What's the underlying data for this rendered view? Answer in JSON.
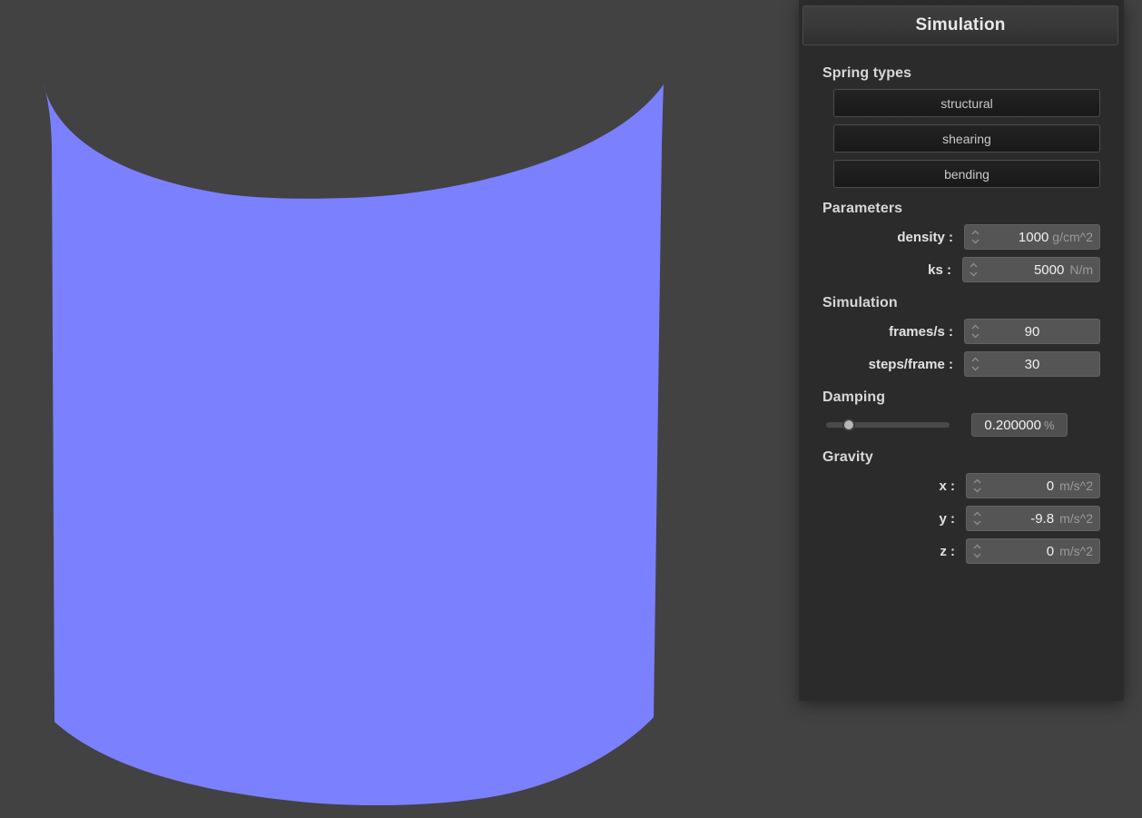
{
  "window": {
    "background_color": "#424242",
    "panel_color": "#2b2b2b"
  },
  "viewport": {
    "name": "cloth-simulation-viewport",
    "cloth_color": "#7b80ff",
    "background_color": "#424242"
  },
  "panel": {
    "title": "Simulation",
    "sections": {
      "spring_types": {
        "header": "Spring types",
        "buttons": [
          {
            "label": "structural",
            "name": "spring-type-structural-button"
          },
          {
            "label": "shearing",
            "name": "spring-type-shearing-button"
          },
          {
            "label": "bending",
            "name": "spring-type-bending-button"
          }
        ]
      },
      "parameters": {
        "header": "Parameters",
        "fields": [
          {
            "label": "density :",
            "value": "1000",
            "unit": "g/cm^2"
          },
          {
            "label": "ks :",
            "value": "5000",
            "unit": "N/m"
          }
        ]
      },
      "simulation": {
        "header": "Simulation",
        "fields": [
          {
            "label": "frames/s :",
            "value": "90",
            "unit": ""
          },
          {
            "label": "steps/frame :",
            "value": "30",
            "unit": ""
          }
        ]
      },
      "damping": {
        "header": "Damping",
        "value": "0.200000",
        "unit": "%",
        "slider_percent": 14
      },
      "gravity": {
        "header": "Gravity",
        "fields": [
          {
            "label": "x :",
            "value": "0",
            "unit": "m/s^2"
          },
          {
            "label": "y :",
            "value": "-9.8",
            "unit": "m/s^2"
          },
          {
            "label": "z :",
            "value": "0",
            "unit": "m/s^2"
          }
        ]
      }
    }
  },
  "icons": {
    "spinner_up": "chevron-up-icon",
    "spinner_down": "chevron-down-icon"
  }
}
